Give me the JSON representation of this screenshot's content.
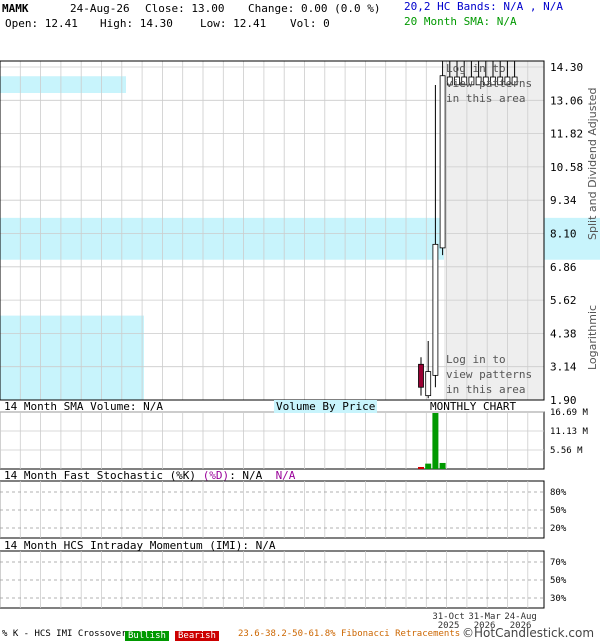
{
  "header": {
    "symbol": "MAMK",
    "date": "24-Aug-26",
    "close": "Close: 13.00",
    "change": "Change: 0.00 (0.0 %)",
    "open": "Open: 12.41",
    "high": "High: 14.30",
    "low": "Low: 12.41",
    "vol": "Vol: 0",
    "bands": "20,2 HC Bands: N/A , N/A",
    "sma": "20 Month SMA: N/A"
  },
  "side_labels": {
    "adjusted": "Split and Dividend Adjusted",
    "log": "Logarithmic"
  },
  "patterns": {
    "line1": "Log in to",
    "line2": "view patterns",
    "line3": "in this area"
  },
  "panels": {
    "volume_title": "14 Month SMA Volume: N/A",
    "vbp_title": "Volume By Price",
    "monthly": "MONTHLY CHART",
    "stoch_title_a": "14 Month Fast Stochastic (%K) ",
    "stoch_title_b": "(%D)",
    "stoch_title_c": ": N/A",
    "stoch_title_d": "N/A",
    "imi_title": "14 Month HCS Intraday Momentum (IMI): N/A"
  },
  "footer": {
    "crossover": "% K - HCS IMI Crossover,",
    "bullish": "Bullish",
    "bearish": "Bearish",
    "fib": "23.6-38.2-50-61.8% Fibonacci Retracements",
    "brand": "©HotCandlestick.com"
  },
  "colors": {
    "up": "#ffffff",
    "down": "#990033",
    "volume": "#009900",
    "vbp": "#c8f4fc",
    "grid": "#cccccc",
    "shade": "#eeeeee"
  },
  "chart_data": {
    "type": "candlestick",
    "y_scale": "log",
    "price_ticks": [
      "14.30",
      "13.06",
      "11.82",
      "10.58",
      "9.34",
      "8.10",
      "6.86",
      "5.62",
      "4.38",
      "3.14",
      "1.90"
    ],
    "volume_ticks": [
      "16.69 M",
      "11.13 M",
      "5.56 M"
    ],
    "stoch_ticks": [
      "80%",
      "50%",
      "20%"
    ],
    "imi_ticks": [
      "70%",
      "50%",
      "30%"
    ],
    "x_ticks": [
      {
        "label1": "31-Oct",
        "label2": "2025",
        "index": 3
      },
      {
        "label1": "31-Mar",
        "label2": "2026",
        "index": 8
      },
      {
        "label1": "24-Aug",
        "label2": "2026",
        "index": 13
      }
    ],
    "ylim": [
      1.9,
      14.3
    ],
    "candles": [
      {
        "i": 0,
        "open": 2.35,
        "close": 2.05,
        "high": 2.45,
        "low": 1.95,
        "dir": "down"
      },
      {
        "i": 1,
        "open": 1.95,
        "close": 2.25,
        "high": 2.7,
        "low": 1.92,
        "dir": "up"
      },
      {
        "i": 2,
        "open": 2.2,
        "close": 4.8,
        "high": 12.4,
        "low": 2.05,
        "dir": "up"
      },
      {
        "i": 3,
        "open": 4.7,
        "close": 13.1,
        "high": 14.3,
        "low": 4.5,
        "dir": "up"
      },
      {
        "i": 4,
        "open": 12.4,
        "close": 13.0,
        "high": 14.3,
        "low": 12.4,
        "dir": "up"
      },
      {
        "i": 5,
        "open": 12.41,
        "close": 13.0,
        "high": 14.3,
        "low": 12.41,
        "dir": "up"
      },
      {
        "i": 6,
        "open": 12.41,
        "close": 13.0,
        "high": 14.3,
        "low": 12.41,
        "dir": "up"
      },
      {
        "i": 7,
        "open": 12.41,
        "close": 13.0,
        "high": 14.3,
        "low": 12.41,
        "dir": "up"
      },
      {
        "i": 8,
        "open": 12.41,
        "close": 13.0,
        "high": 14.3,
        "low": 12.41,
        "dir": "up"
      },
      {
        "i": 9,
        "open": 12.41,
        "close": 13.0,
        "high": 14.3,
        "low": 12.41,
        "dir": "up"
      },
      {
        "i": 10,
        "open": 12.41,
        "close": 13.0,
        "high": 14.3,
        "low": 12.41,
        "dir": "up"
      },
      {
        "i": 11,
        "open": 12.41,
        "close": 13.0,
        "high": 14.3,
        "low": 12.41,
        "dir": "up"
      },
      {
        "i": 12,
        "open": 12.41,
        "close": 13.0,
        "high": 14.3,
        "low": 12.41,
        "dir": "up"
      },
      {
        "i": 13,
        "open": 12.41,
        "close": 13.0,
        "high": 14.3,
        "low": 12.41,
        "dir": "up"
      }
    ],
    "volume_max_m": 16.69,
    "volumes_m": [
      0.6,
      1.6,
      16.69,
      1.8,
      0,
      0,
      0,
      0,
      0,
      0,
      0,
      0,
      0,
      0
    ],
    "volume_by_price": [
      {
        "low": 11.82,
        "high": 13.06,
        "strength": 0.21
      },
      {
        "low": 4.38,
        "high": 5.62,
        "strength": 1.0
      },
      {
        "low": 1.9,
        "high": 3.14,
        "strength": 0.24
      }
    ]
  }
}
